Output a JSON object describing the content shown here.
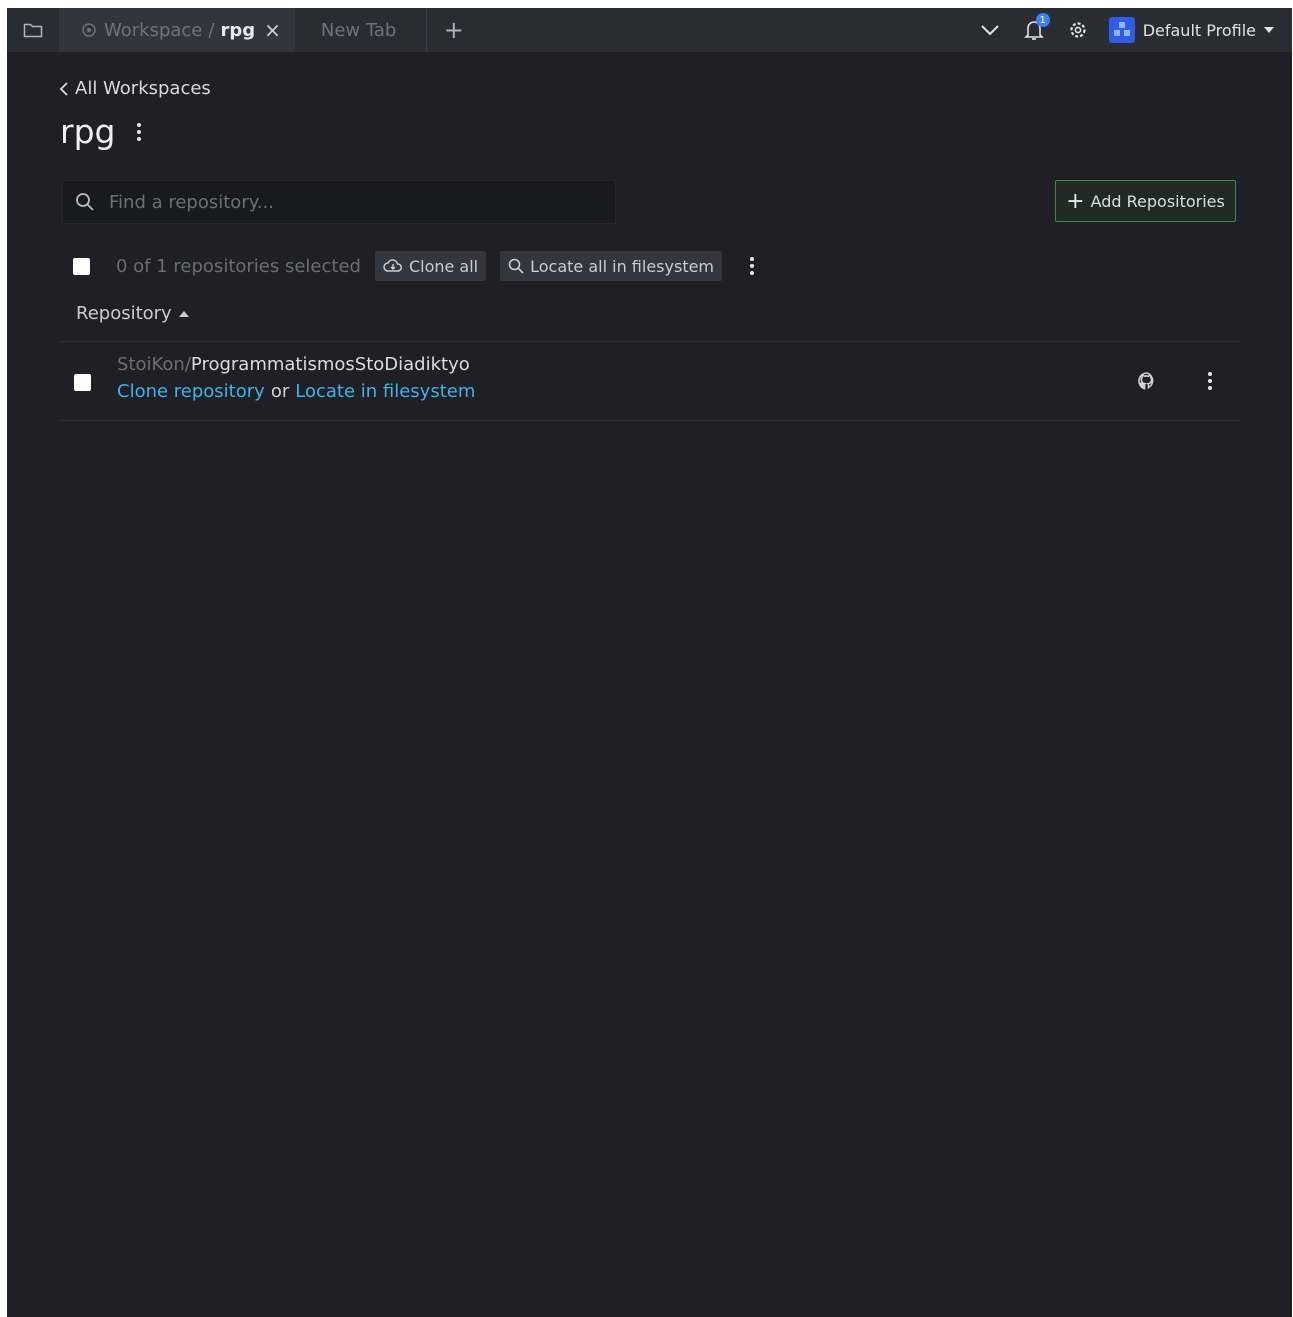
{
  "tabs": {
    "active": {
      "crumb_1": "Workspace",
      "separator": "/",
      "crumb_2": "rpg",
      "close": "×"
    },
    "inactive": {
      "label": "New Tab"
    },
    "add": "+"
  },
  "header": {
    "notification_count": "1",
    "profile_name": "Default Profile"
  },
  "nav": {
    "back_label": "All Workspaces"
  },
  "page": {
    "title": "rpg"
  },
  "search": {
    "placeholder": "Find a repository..."
  },
  "actions": {
    "add_repositories": "Add Repositories",
    "add_plus": "+"
  },
  "toolbar": {
    "selected_text": "0 of 1 repositories selected",
    "clone_all": "Clone all",
    "locate_all": "Locate all in filesystem"
  },
  "table": {
    "column_header": "Repository",
    "rows": [
      {
        "owner": "StoiKon",
        "slash": "/",
        "name": "ProgrammatismosStoDiadiktyo",
        "clone_link": "Clone repository",
        "or": "or",
        "locate_link": "Locate in filesystem"
      }
    ]
  },
  "colors": {
    "background": "#1f1f25",
    "tabbar": "#2a2c33",
    "link": "#3db3e6",
    "add_button_border": "#3e8a4c",
    "notification_badge": "#3c7ff0",
    "avatar": "#2e5ce6"
  },
  "icons": [
    "folder-icon",
    "workspace-icon",
    "close-icon",
    "plus-icon",
    "chevron-down-icon",
    "bell-icon",
    "gear-icon",
    "avatar-icon",
    "chevron-left-icon",
    "kebab-icon",
    "search-icon",
    "cloud-download-icon",
    "github-icon"
  ]
}
